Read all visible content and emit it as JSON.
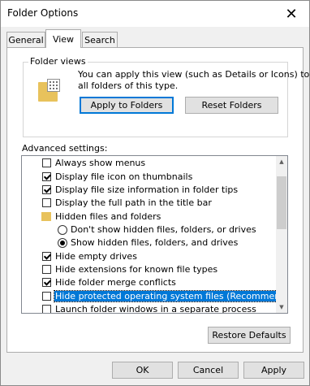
{
  "window": {
    "title": "Folder Options",
    "close_glyph": "✕"
  },
  "tabs": [
    {
      "label": "General",
      "active": false
    },
    {
      "label": "View",
      "active": true
    },
    {
      "label": "Search",
      "active": false
    }
  ],
  "folder_views": {
    "label": "Folder views",
    "description_line1": "You can apply this view (such as Details or Icons) to",
    "description_line2": "all folders of this type.",
    "apply_label": "Apply to Folders",
    "reset_label": "Reset Folders"
  },
  "advanced": {
    "label": "Advanced settings:",
    "items": [
      {
        "kind": "checkbox",
        "label": "Always show menus",
        "checked": false
      },
      {
        "kind": "checkbox",
        "label": "Display file icon on thumbnails",
        "checked": true
      },
      {
        "kind": "checkbox",
        "label": "Display file size information in folder tips",
        "checked": true
      },
      {
        "kind": "checkbox",
        "label": "Display the full path in the title bar",
        "checked": false
      },
      {
        "kind": "folder",
        "label": "Hidden files and folders"
      },
      {
        "kind": "radio",
        "label": "Don't show hidden files, folders, or drives",
        "checked": false
      },
      {
        "kind": "radio",
        "label": "Show hidden files, folders, and drives",
        "checked": true
      },
      {
        "kind": "checkbox",
        "label": "Hide empty drives",
        "checked": true
      },
      {
        "kind": "checkbox",
        "label": "Hide extensions for known file types",
        "checked": false
      },
      {
        "kind": "checkbox",
        "label": "Hide folder merge conflicts",
        "checked": true
      },
      {
        "kind": "checkbox",
        "label": "Hide protected operating system files (Recommended)",
        "checked": false,
        "selected": true
      },
      {
        "kind": "checkbox",
        "label": "Launch folder windows in a separate process",
        "checked": false
      }
    ],
    "restore_label": "Restore Defaults"
  },
  "footer": {
    "ok_label": "OK",
    "cancel_label": "Cancel",
    "apply_label": "Apply"
  },
  "colors": {
    "selection": "#0078d7",
    "folder": "#e8c25c"
  }
}
